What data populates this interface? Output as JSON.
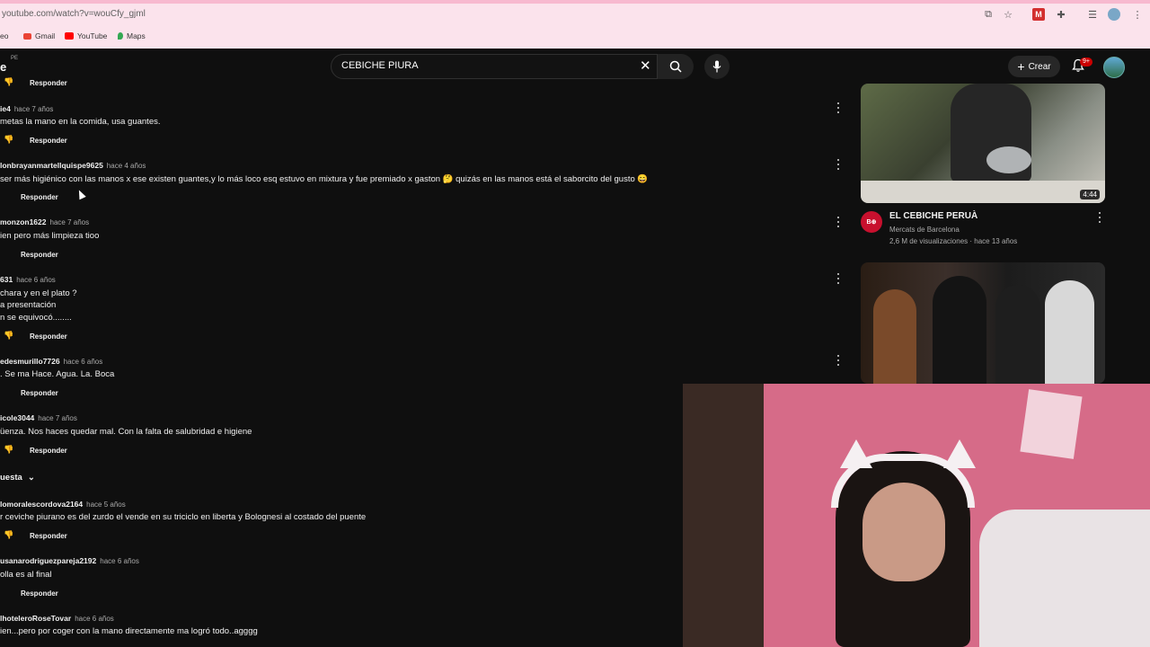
{
  "browser": {
    "url": "youtube.com/watch?v=wouCfy_gjml",
    "bookmarks": [
      "eo",
      "Gmail",
      "YouTube",
      "Maps"
    ]
  },
  "header": {
    "logo_fragment": "e",
    "region": "PE",
    "search_value": "CEBICHE PIURA",
    "create_label": "Crear",
    "notif_badge": "9+"
  },
  "comments": [
    {
      "reply": "Responder"
    },
    {
      "user": "ie4",
      "time": "hace 7 años",
      "text": "metas la mano en la comida, usa guantes.",
      "reply": "Responder"
    },
    {
      "user": "lonbrayanmartellquispe9625",
      "time": "hace 4 años",
      "text": "ser más higiénico con las manos x ese existen guantes,y lo más loco esq estuvo en mixtura y fue premiado x gaston 🤔 quizás en las manos está el saborcito del gusto 😄",
      "reply": "Responder"
    },
    {
      "user": "monzon1622",
      "time": "hace 7 años",
      "text": "ien pero más limpieza tioo",
      "reply": "Responder"
    },
    {
      "user": "631",
      "time": "hace 6 años",
      "text1": "chara y en el plato ?",
      "text2": "a presentación",
      "text3": "n se equivocó........",
      "reply": "Responder"
    },
    {
      "user": "edesmurillo7726",
      "time": "hace 6 años",
      "text": ". Se ma Hace. Agua. La. Boca",
      "reply": "Responder"
    },
    {
      "user": "icole3044",
      "time": "hace 7 años",
      "text": "üenza. Nos haces quedar mal. Con la falta de salubridad e higiene",
      "reply": "Responder"
    },
    {
      "user": "lomoralescordova2164",
      "time": "hace 5 años",
      "text": "r ceviche piurano es del zurdo el vende en su triciclo en liberta y Bolognesi  al costado del puente",
      "reply": "Responder"
    },
    {
      "user": "usanarodriguezpareja2192",
      "time": "hace 6 años",
      "text": "olla es al final",
      "reply": "Responder"
    },
    {
      "user": "lhoteleroRoseTovar",
      "time": "hace 6 años",
      "text": "ien...pero por coger con la  mano directamente  ma logró todo..agggg"
    }
  ],
  "replies_toggle": "uesta",
  "sidebar": {
    "video1": {
      "duration": "4:44",
      "title": "EL CEBICHE PERUÀ",
      "channel": "Mercats de Barcelona",
      "meta": "2,6 M de visualizaciones · hace 13 años",
      "channel_avatar": "B⊕"
    }
  }
}
